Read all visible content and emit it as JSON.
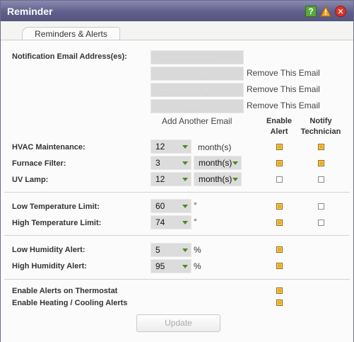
{
  "window": {
    "title": "Reminder"
  },
  "titlebar_icons": [
    "help-icon",
    "warning-icon",
    "close-icon"
  ],
  "tabs": [
    {
      "label": "Reminders & Alerts",
      "active": true
    }
  ],
  "email": {
    "label": "Notification Email Address(es):",
    "entries": [
      {
        "value": "· · · · · · ·",
        "remove_label": ""
      },
      {
        "value": "·  ·  · ·· ·· ··",
        "remove_label": "Remove This Email"
      },
      {
        "value": "·· ·  ·  · · ·",
        "remove_label": "Remove This Email"
      },
      {
        "value": "·  ·",
        "remove_label": "Remove This Email"
      }
    ],
    "add_label": "Add Another Email"
  },
  "columns": {
    "enable_alert": "Enable\nAlert",
    "notify_technician": "Notify\nTechnician"
  },
  "maintenance": [
    {
      "label": "HVAC Maintenance:",
      "value": "12",
      "unit": "month(s)",
      "unit_is_select": false,
      "enable": true,
      "notify": true
    },
    {
      "label": "Furnace Filter:",
      "value": "3",
      "unit": "month(s)",
      "unit_is_select": true,
      "enable": true,
      "notify": true
    },
    {
      "label": "UV Lamp:",
      "value": "12",
      "unit": "month(s)",
      "unit_is_select": true,
      "enable": false,
      "notify": false
    }
  ],
  "temperature": [
    {
      "label": "Low Temperature Limit:",
      "value": "60",
      "unit": "°",
      "enable": true,
      "notify": false
    },
    {
      "label": "High Temperature Limit:",
      "value": "74",
      "unit": "°",
      "enable": true,
      "notify": false
    }
  ],
  "humidity": [
    {
      "label": "Low Humidity Alert:",
      "value": "5",
      "unit": "%",
      "enable": true
    },
    {
      "label": "High Humidity Alert:",
      "value": "95",
      "unit": "%",
      "enable": true
    }
  ],
  "thermostat": [
    {
      "label": "Enable Alerts on Thermostat",
      "enable": true
    },
    {
      "label": "Enable Heating / Cooling Alerts",
      "enable": true
    }
  ],
  "update_button": {
    "label": "Update",
    "enabled": false
  },
  "colors": {
    "titlebar": "#5f5f8c",
    "checkbox_on": "#f0a91a",
    "select_arrow": "#4a8a1f"
  }
}
